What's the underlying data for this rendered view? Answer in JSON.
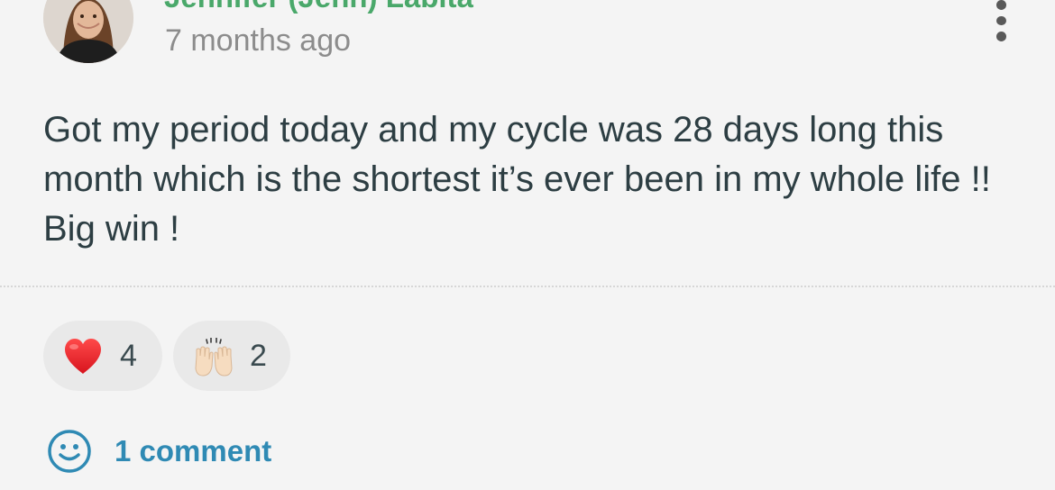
{
  "post": {
    "author": {
      "name": "Jennifer (Jenn) Labita",
      "avatar_icon": "profile-photo"
    },
    "timestamp": "7 months ago",
    "more_menu_icon": "vertical-ellipsis-icon",
    "body": "Got my period today and my cycle was 28 days long this month which is the shortest it’s ever been in my whole life !! Big win !"
  },
  "reactions": [
    {
      "icon": "red-heart-emoji",
      "count": "4"
    },
    {
      "icon": "raising-hands-emoji",
      "count": "2"
    }
  ],
  "comments": {
    "icon": "smiley-face-icon",
    "label": "1 comment"
  },
  "colors": {
    "background": "#f4f4f4",
    "author_name": "#4aa86a",
    "timestamp": "#8c8c8c",
    "body_text": "#2d3e43",
    "comment_link": "#2f8ab4",
    "reaction_pill": "#e9e9e9"
  }
}
